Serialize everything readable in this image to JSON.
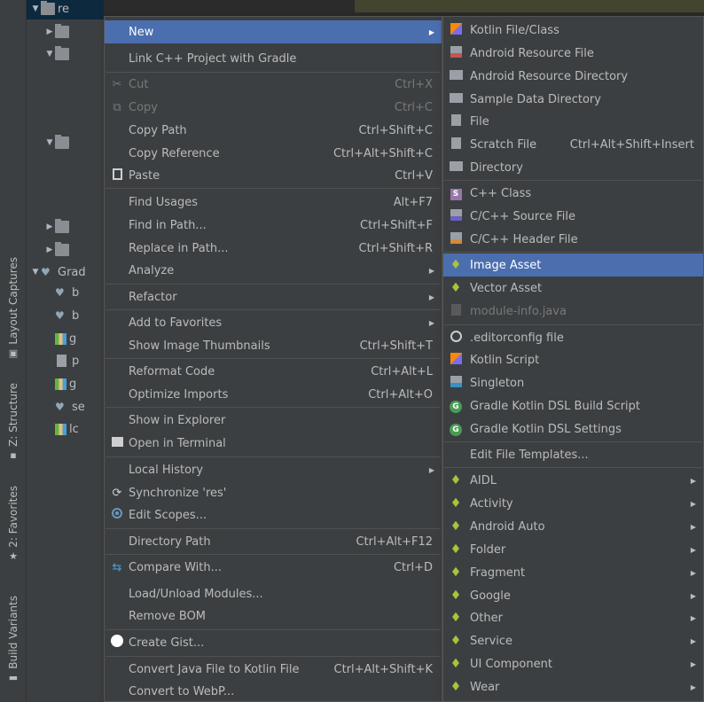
{
  "side_tabs": [
    {
      "label": "Layout Captures",
      "icon": "layout-captures-icon"
    },
    {
      "label": "Z: Structure",
      "icon": "structure-icon"
    },
    {
      "label": "2: Favorites",
      "icon": "star-icon"
    },
    {
      "label": "Build Variants",
      "icon": "build-variants-icon"
    }
  ],
  "tree": {
    "rows": [
      {
        "arrow": "▼",
        "icon": "folder",
        "label": "re"
      },
      {
        "arrow": "▶",
        "icon": "folder",
        "label": ""
      },
      {
        "arrow": "▼",
        "icon": "folder",
        "label": ""
      },
      {
        "arrow": "▼",
        "icon": "folder",
        "label": ""
      },
      {
        "arrow": "▶",
        "icon": "folder",
        "label": ""
      },
      {
        "arrow": "▶",
        "icon": "folder",
        "label": ""
      },
      {
        "arrow": "▼",
        "icon": "gradle",
        "label": "Grad"
      },
      {
        "arrow": "",
        "icon": "gradle",
        "label": "b"
      },
      {
        "arrow": "",
        "icon": "gradle",
        "label": "b"
      },
      {
        "arrow": "",
        "icon": "chart",
        "label": "g"
      },
      {
        "arrow": "",
        "icon": "file",
        "label": "p"
      },
      {
        "arrow": "",
        "icon": "chart",
        "label": "g"
      },
      {
        "arrow": "",
        "icon": "gradle",
        "label": "se"
      },
      {
        "arrow": "",
        "icon": "chart",
        "label": "lc"
      }
    ]
  },
  "menu1": {
    "items": [
      {
        "label": "New",
        "shortcut": "",
        "submenu": true,
        "highlighted": true,
        "icon": ""
      },
      {
        "label": "Link C++ Project with Gradle",
        "shortcut": "",
        "submenu": false,
        "icon": ""
      },
      {
        "label": "Cut",
        "shortcut": "Ctrl+X",
        "disabled": true,
        "icon": "scissors-icon"
      },
      {
        "label": "Copy",
        "shortcut": "Ctrl+C",
        "disabled": true,
        "icon": "copy-icon"
      },
      {
        "label": "Copy Path",
        "shortcut": "Ctrl+Shift+C",
        "icon": ""
      },
      {
        "label": "Copy Reference",
        "shortcut": "Ctrl+Alt+Shift+C",
        "icon": ""
      },
      {
        "label": "Paste",
        "shortcut": "Ctrl+V",
        "icon": "clipboard-icon"
      },
      {
        "label": "Find Usages",
        "shortcut": "Alt+F7",
        "icon": ""
      },
      {
        "label": "Find in Path...",
        "shortcut": "Ctrl+Shift+F",
        "icon": ""
      },
      {
        "label": "Replace in Path...",
        "shortcut": "Ctrl+Shift+R",
        "icon": ""
      },
      {
        "label": "Analyze",
        "shortcut": "",
        "submenu": true,
        "icon": ""
      },
      {
        "label": "Refactor",
        "shortcut": "",
        "submenu": true,
        "icon": ""
      },
      {
        "label": "Add to Favorites",
        "shortcut": "",
        "submenu": true,
        "icon": ""
      },
      {
        "label": "Show Image Thumbnails",
        "shortcut": "Ctrl+Shift+T",
        "icon": ""
      },
      {
        "label": "Reformat Code",
        "shortcut": "Ctrl+Alt+L",
        "icon": ""
      },
      {
        "label": "Optimize Imports",
        "shortcut": "Ctrl+Alt+O",
        "icon": ""
      },
      {
        "label": "Show in Explorer",
        "shortcut": "",
        "icon": ""
      },
      {
        "label": "Open in Terminal",
        "shortcut": "",
        "icon": "terminal-icon"
      },
      {
        "label": "Local History",
        "shortcut": "",
        "submenu": true,
        "icon": ""
      },
      {
        "label": "Synchronize 'res'",
        "shortcut": "",
        "icon": "sync-icon"
      },
      {
        "label": "Edit Scopes...",
        "shortcut": "",
        "icon": "scope-icon"
      },
      {
        "label": "Directory Path",
        "shortcut": "Ctrl+Alt+F12",
        "icon": ""
      },
      {
        "label": "Compare With...",
        "shortcut": "Ctrl+D",
        "icon": "compare-icon"
      },
      {
        "label": "Load/Unload Modules...",
        "shortcut": "",
        "icon": ""
      },
      {
        "label": "Remove BOM",
        "shortcut": "",
        "icon": ""
      },
      {
        "label": "Create Gist...",
        "shortcut": "",
        "icon": "github-icon"
      },
      {
        "label": "Convert Java File to Kotlin File",
        "shortcut": "Ctrl+Alt+Shift+K",
        "icon": ""
      },
      {
        "label": "Convert to WebP...",
        "shortcut": "",
        "icon": ""
      }
    ]
  },
  "menu2": {
    "items": [
      {
        "label": "Kotlin File/Class",
        "shortcut": "",
        "icon": "kotlin-icon"
      },
      {
        "label": "Android Resource File",
        "shortcut": "",
        "icon": "resource-file-icon"
      },
      {
        "label": "Android Resource Directory",
        "shortcut": "",
        "icon": "directory-icon"
      },
      {
        "label": "Sample Data Directory",
        "shortcut": "",
        "icon": "directory-icon"
      },
      {
        "label": "File",
        "shortcut": "",
        "icon": "file-icon"
      },
      {
        "label": "Scratch File",
        "shortcut": "Ctrl+Alt+Shift+Insert",
        "icon": "scratch-file-icon"
      },
      {
        "label": "Directory",
        "shortcut": "",
        "icon": "directory-icon"
      },
      {
        "label": "C++ Class",
        "shortcut": "",
        "icon": "cpp-class-icon"
      },
      {
        "label": "C/C++ Source File",
        "shortcut": "",
        "icon": "cpp-source-icon"
      },
      {
        "label": "C/C++ Header File",
        "shortcut": "",
        "icon": "cpp-header-icon"
      },
      {
        "label": "Image Asset",
        "shortcut": "",
        "highlighted": true,
        "icon": "android-icon"
      },
      {
        "label": "Vector Asset",
        "shortcut": "",
        "icon": "android-icon"
      },
      {
        "label": "module-info.java",
        "shortcut": "",
        "disabled": true,
        "icon": "module-info-icon"
      },
      {
        "label": ".editorconfig file",
        "shortcut": "",
        "icon": "editorconfig-icon"
      },
      {
        "label": "Kotlin Script",
        "shortcut": "",
        "icon": "kotlin-icon"
      },
      {
        "label": "Singleton",
        "shortcut": "",
        "icon": "singleton-icon"
      },
      {
        "label": "Gradle Kotlin DSL Build Script",
        "shortcut": "",
        "icon": "gradle-icon"
      },
      {
        "label": "Gradle Kotlin DSL Settings",
        "shortcut": "",
        "icon": "gradle-icon"
      },
      {
        "label": "Edit File Templates...",
        "shortcut": "",
        "icon": ""
      },
      {
        "label": "AIDL",
        "submenu": true,
        "icon": "android-icon"
      },
      {
        "label": "Activity",
        "submenu": true,
        "icon": "android-icon"
      },
      {
        "label": "Android Auto",
        "submenu": true,
        "icon": "android-icon"
      },
      {
        "label": "Folder",
        "submenu": true,
        "icon": "android-icon"
      },
      {
        "label": "Fragment",
        "submenu": true,
        "icon": "android-icon"
      },
      {
        "label": "Google",
        "submenu": true,
        "icon": "android-icon"
      },
      {
        "label": "Other",
        "submenu": true,
        "icon": "android-icon"
      },
      {
        "label": "Service",
        "submenu": true,
        "icon": "android-icon"
      },
      {
        "label": "UI Component",
        "submenu": true,
        "icon": "android-icon"
      },
      {
        "label": "Wear",
        "submenu": true,
        "icon": "android-icon"
      }
    ]
  },
  "colors": {
    "menu_bg": "#3c3f41",
    "highlight": "#4b6eaf",
    "android_green": "#a4c639"
  }
}
